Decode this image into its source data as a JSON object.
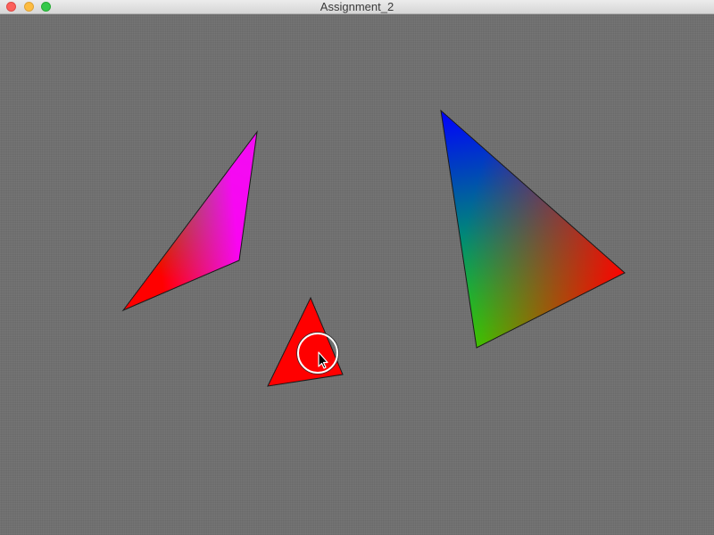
{
  "window": {
    "title": "Assignment_2"
  },
  "colors": {
    "background": "#707070",
    "red": "#ff0000",
    "green": "#00ff00",
    "blue": "#0000ff",
    "magenta": "#ff00ff",
    "edge": "#1a1a1a",
    "cursor_ring": "#ffffff"
  },
  "icons": {
    "close": "close-icon",
    "minimize": "minimize-icon",
    "zoom": "zoom-icon",
    "cursor": "arrow-cursor-icon"
  }
}
